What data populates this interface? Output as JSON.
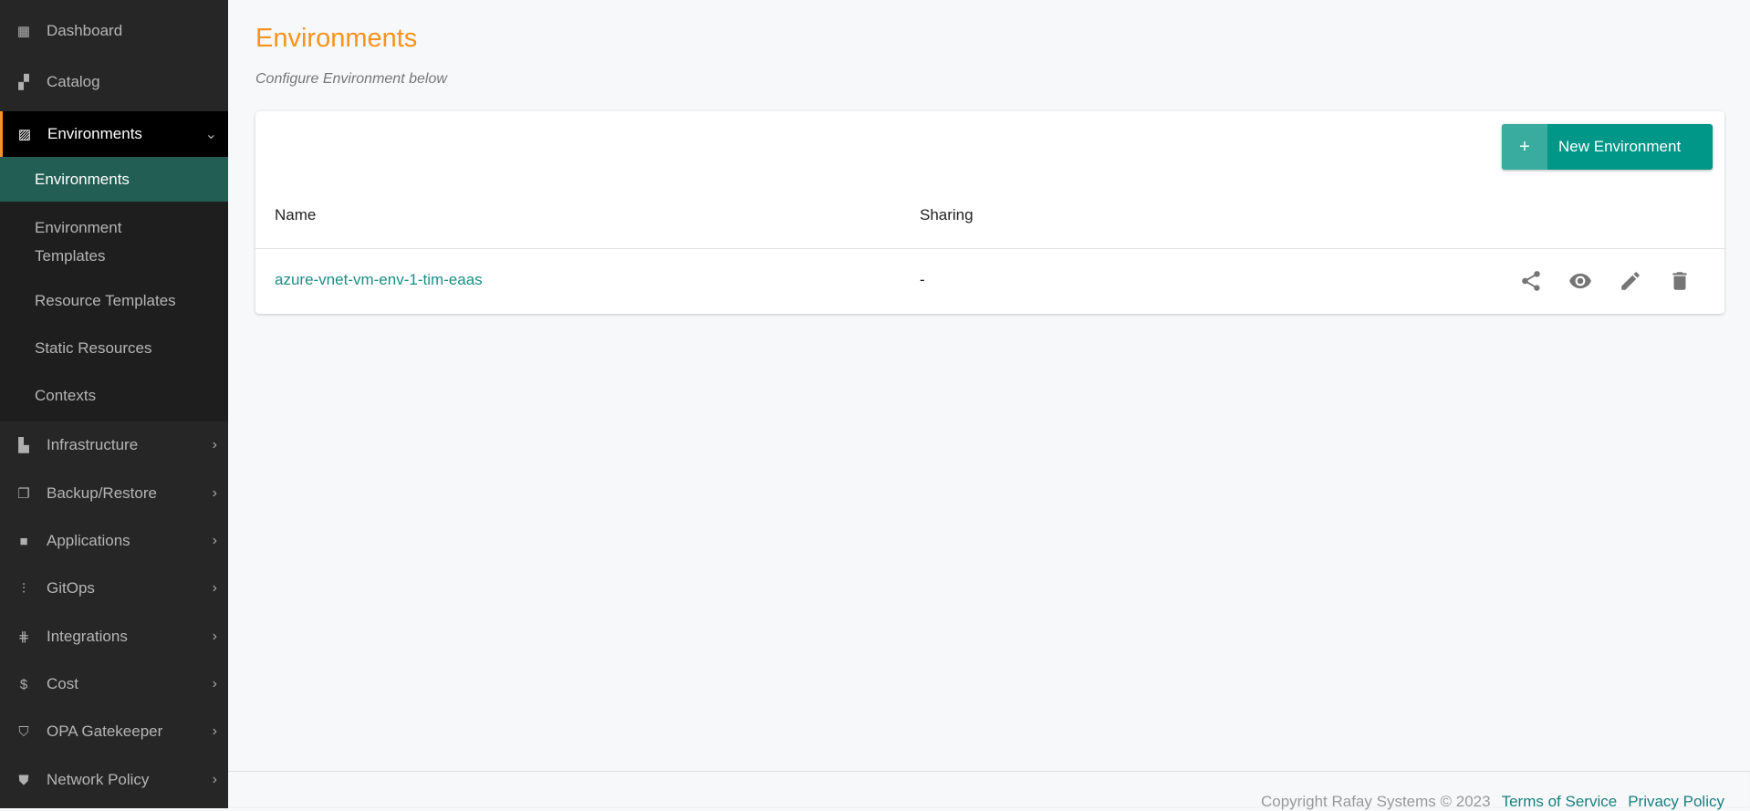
{
  "sidebar": {
    "top_items": [
      {
        "label": "Dashboard",
        "icon": "dashboard-icon"
      },
      {
        "label": "Catalog",
        "icon": "catalog-icon"
      }
    ],
    "open_section": {
      "label": "Environments",
      "icon": "image-icon",
      "sub_items": [
        {
          "label": "Environments",
          "active": true
        },
        {
          "label": "Environment Templates"
        },
        {
          "label": "Resource Templates"
        },
        {
          "label": "Static Resources"
        },
        {
          "label": "Contexts"
        }
      ]
    },
    "items": [
      {
        "label": "Infrastructure",
        "icon": "building-icon"
      },
      {
        "label": "Backup/Restore",
        "icon": "copy-icon"
      },
      {
        "label": "Applications",
        "icon": "briefcase-icon"
      },
      {
        "label": "GitOps",
        "icon": "waveform-icon"
      },
      {
        "label": "Integrations",
        "icon": "sliders-icon"
      },
      {
        "label": "Cost",
        "icon": "dollar-icon"
      },
      {
        "label": "OPA Gatekeeper",
        "icon": "shield-icon"
      },
      {
        "label": "Network Policy",
        "icon": "shield-check-icon"
      }
    ]
  },
  "page": {
    "title": "Environments",
    "subtitle": "Configure Environment below",
    "new_button": "New Environment",
    "new_button_icon": "+"
  },
  "table": {
    "headers": [
      "Name",
      "Sharing"
    ],
    "rows": [
      {
        "name": "azure-vnet-vm-env-1-tim-eaas",
        "sharing": "-"
      }
    ]
  },
  "footer": {
    "copyright": "Copyright Rafay Systems © 2023",
    "terms": "Terms of Service",
    "privacy": "Privacy Policy"
  },
  "colors": {
    "accent": "#f7931e",
    "primary": "#009688",
    "active_nav": "#235e54"
  }
}
